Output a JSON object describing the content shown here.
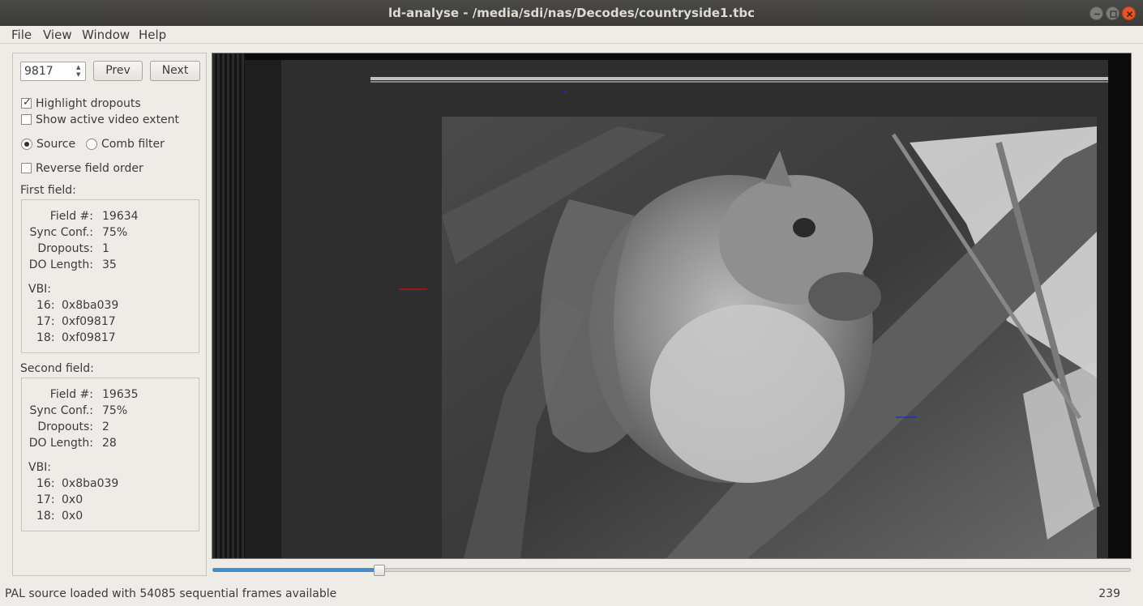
{
  "window": {
    "title": "ld-analyse - /media/sdi/nas/Decodes/countryside1.tbc"
  },
  "menu": {
    "file": "File",
    "view": "View",
    "window": "Window",
    "help": "Help"
  },
  "controls": {
    "frame_number": "9817",
    "prev_label": "Prev",
    "next_label": "Next",
    "highlight_dropouts": {
      "label": "Highlight dropouts",
      "checked": true
    },
    "show_active_video": {
      "label": "Show active video extent",
      "checked": false
    },
    "source_mode": {
      "source_label": "Source",
      "comb_label": "Comb filter",
      "selected": "source"
    },
    "reverse_field_order": {
      "label": "Reverse field order",
      "checked": false
    }
  },
  "first_field": {
    "heading": "First field:",
    "field_num_label": "Field #:",
    "field_num": "19634",
    "sync_label": "Sync Conf.:",
    "sync": "75%",
    "dropouts_label": "Dropouts:",
    "dropouts": "1",
    "do_length_label": "DO Length:",
    "do_length": "35",
    "vbi_label": "VBI:",
    "vbi": [
      {
        "line": "16:",
        "value": "0x8ba039"
      },
      {
        "line": "17:",
        "value": "0xf09817"
      },
      {
        "line": "18:",
        "value": "0xf09817"
      }
    ]
  },
  "second_field": {
    "heading": "Second field:",
    "field_num_label": "Field #:",
    "field_num": "19635",
    "sync_label": "Sync Conf.:",
    "sync": "75%",
    "dropouts_label": "Dropouts:",
    "dropouts": "2",
    "do_length_label": "DO Length:",
    "do_length": "28",
    "vbi_label": "VBI:",
    "vbi": [
      {
        "line": "16:",
        "value": "0x8ba039"
      },
      {
        "line": "17:",
        "value": "0x0"
      },
      {
        "line": "18:",
        "value": "0x0"
      }
    ]
  },
  "frame_slider": {
    "position_fraction": 0.1815
  },
  "status": {
    "message": "PAL source loaded with 54085 sequential frames available",
    "right_value": "239"
  },
  "colors": {
    "accent": "#3e8ed0",
    "close_button": "#e95420",
    "dropout_first_field": "#cc1111",
    "dropout_second_field": "#1a2bd0"
  }
}
